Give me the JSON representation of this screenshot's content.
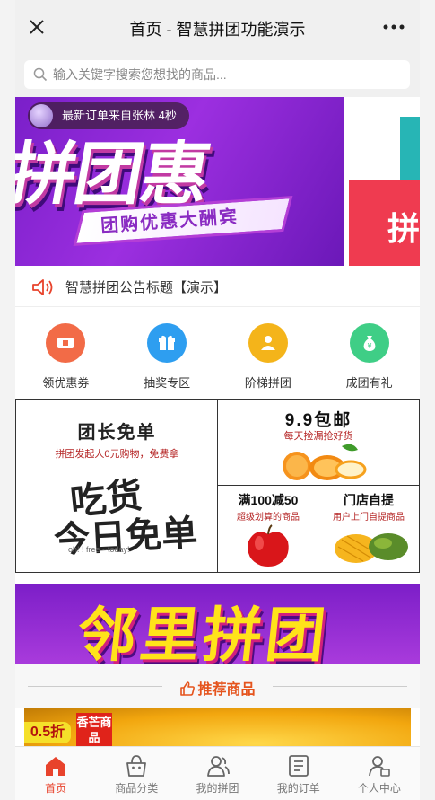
{
  "header": {
    "title": "首页 - 智慧拼团功能演示",
    "close_icon": "close-icon",
    "more_icon": "more-icon"
  },
  "search": {
    "placeholder": "输入关键字搜索您想找的商品..."
  },
  "banner": {
    "order_ticker": "最新订单来自张林 4秒",
    "headline": "拼团惠",
    "ribbon_text": "团购优惠大酬宾",
    "next_slide_char": "拼"
  },
  "notice": {
    "icon": "speaker-icon",
    "text": "智慧拼团公告标题【演示】"
  },
  "shortcuts": [
    {
      "label": "领优惠券",
      "icon": "coupon-icon",
      "color": "#f26b47"
    },
    {
      "label": "抽奖专区",
      "icon": "gift-icon",
      "color": "#2e9ef0"
    },
    {
      "label": "阶梯拼团",
      "icon": "group-icon",
      "color": "#f4b41a"
    },
    {
      "label": "成团有礼",
      "icon": "money-bag-icon",
      "color": "#3fce86"
    }
  ],
  "promo": {
    "leader": {
      "title": "团长免单",
      "subtitle": "拼团发起人0元购物，免费拿",
      "art_line1": "吃货",
      "art_line2": "今日免单",
      "footer": "oh! ! free --today!"
    },
    "cheap": {
      "title": "9.9包邮",
      "subtitle": "每天捡漏抢好货"
    },
    "discount": {
      "title": "满100减50",
      "subtitle": "超级划算的商品"
    },
    "pickup": {
      "title": "门店自提",
      "subtitle": "用户上门自提商品"
    }
  },
  "banner2": {
    "text": "邻里拼团"
  },
  "recommend": {
    "title": "推荐商品",
    "icon": "thumbs-up-icon"
  },
  "product": {
    "discount": "0.5折",
    "name": "香芒商品"
  },
  "tabbar": [
    {
      "label": "首页",
      "icon": "home-icon",
      "active": true
    },
    {
      "label": "商品分类",
      "icon": "basket-icon",
      "active": false
    },
    {
      "label": "我的拼团",
      "icon": "people-icon",
      "active": false
    },
    {
      "label": "我的订单",
      "icon": "order-icon",
      "active": false
    },
    {
      "label": "个人中心",
      "icon": "user-center-icon",
      "active": false
    }
  ],
  "colors": {
    "accent": "#e8432c",
    "brand_purple": "#8a2bc2"
  }
}
